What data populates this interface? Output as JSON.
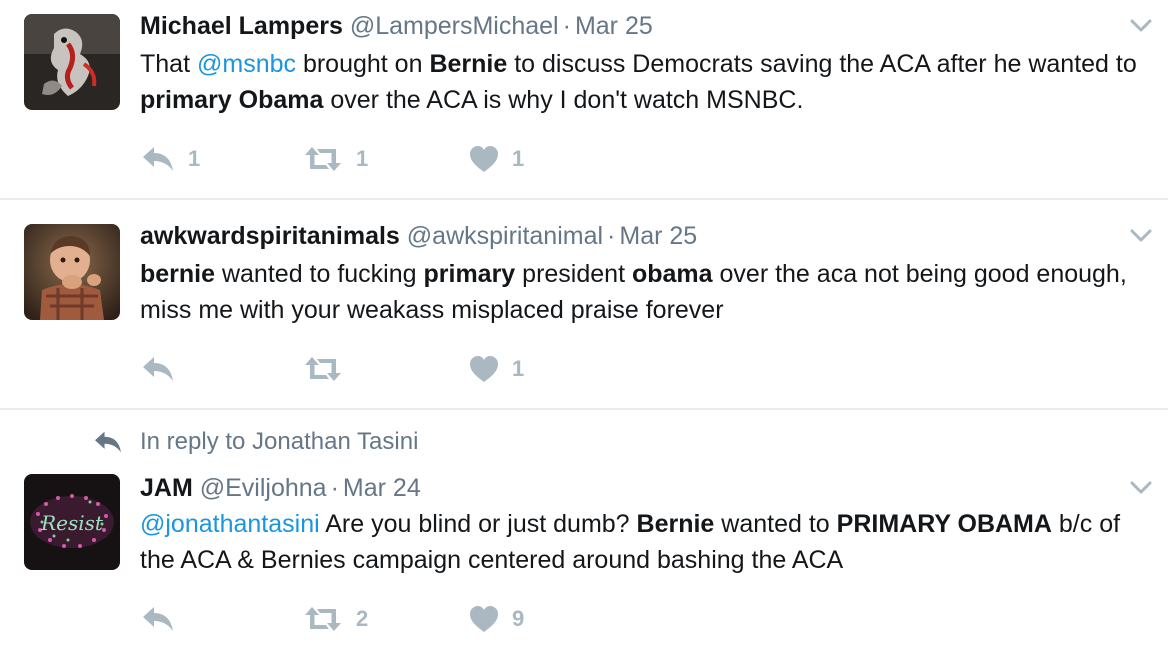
{
  "colors": {
    "text": "#14171a",
    "secondary": "#657786",
    "link": "#1b95e0",
    "action_gray": "#aab8c2",
    "divider": "#e6ecf0"
  },
  "icons": {
    "reply": "reply-arrow-icon",
    "retweet": "retweet-icon",
    "like": "heart-icon",
    "more": "chevron-down-icon"
  },
  "tweets": [
    {
      "name": "Michael Lampers",
      "handle": "@LampersMichael",
      "separator": "·",
      "date": "Mar 25",
      "text": {
        "p1": "That ",
        "p2": "@msnbc",
        "p3": " brought on ",
        "p4": "Bernie",
        "p5": " to discuss Democrats saving the ACA after he wanted to ",
        "p6": "primary Obama",
        "p7": " over the ACA is why I don't watch MSNBC."
      },
      "replies": "1",
      "retweets": "1",
      "likes": "1"
    },
    {
      "name": "awkwardspiritanimals",
      "handle": "@awkspiritanimal",
      "separator": "·",
      "date": "Mar 25",
      "text": {
        "p1": "bernie",
        "p2": " wanted to fucking ",
        "p3": "primary",
        "p4": " president ",
        "p5": "obama",
        "p6": " over the aca not being good enough, miss me with your weakass misplaced praise forever"
      },
      "replies": "",
      "retweets": "",
      "likes": "1"
    },
    {
      "reply_context": "In reply to Jonathan Tasini",
      "name": "JAM",
      "handle": "@Eviljohna",
      "separator": "·",
      "date": "Mar 24",
      "avatar_text": "Resist",
      "text": {
        "p1": "@jonathantasini",
        "p2": " Are you blind or just dumb? ",
        "p3": "Bernie",
        "p4": " wanted to ",
        "p5": "PRIMARY OBAMA",
        "p6": " b/c of the ACA & Bernies campaign centered around bashing the ACA"
      },
      "replies": "",
      "retweets": "2",
      "likes": "9"
    }
  ]
}
